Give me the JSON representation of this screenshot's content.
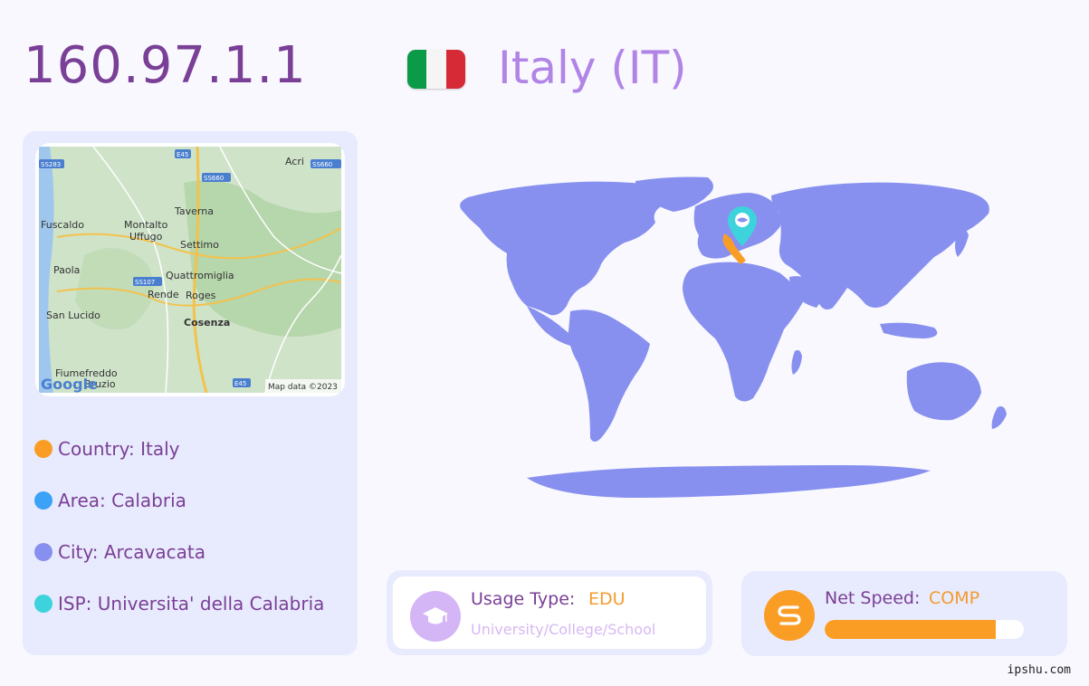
{
  "ip": "160.97.1.1",
  "country_title": "Italy (IT)",
  "flag": {
    "colors": [
      "#0b9a48",
      "#ffffff",
      "#d62b36"
    ]
  },
  "map_panel": {
    "labels": [
      "Acri",
      "Fuscaldo",
      "Montalto",
      "Uffugo",
      "Taverna",
      "Settimo",
      "Paola",
      "Quattromiglia",
      "Rende",
      "Roges",
      "San Lucido",
      "Cosenza",
      "Fiumefreddo",
      "Bruzio"
    ],
    "road_labels": [
      "E45",
      "SS283",
      "SS660",
      "SS660",
      "SS107",
      "E45"
    ],
    "google_label": "Google",
    "attribution": "Map data ©2023"
  },
  "info": [
    {
      "label": "Country: Italy",
      "color": "#fa9d25"
    },
    {
      "label": "Area: Calabria",
      "color": "#3ba2f5"
    },
    {
      "label": "City: Arcavacata",
      "color": "#8890ef"
    },
    {
      "label": "ISP: Universita' della Calabria",
      "color": "#3dd3dc"
    }
  ],
  "usage": {
    "label": "Usage Type:",
    "value": "EDU",
    "description": "University/College/School",
    "icon": "graduation-cap-icon"
  },
  "speed": {
    "label": "Net Speed:",
    "value": "COMP",
    "level": 0.86,
    "icon": "speed-s-icon"
  },
  "colors": {
    "primary": "#7a3f96",
    "accent_orange": "#fa9d25",
    "land": "#8890ef",
    "marker": "#3dd3dc"
  },
  "watermark": "ipshu.com"
}
